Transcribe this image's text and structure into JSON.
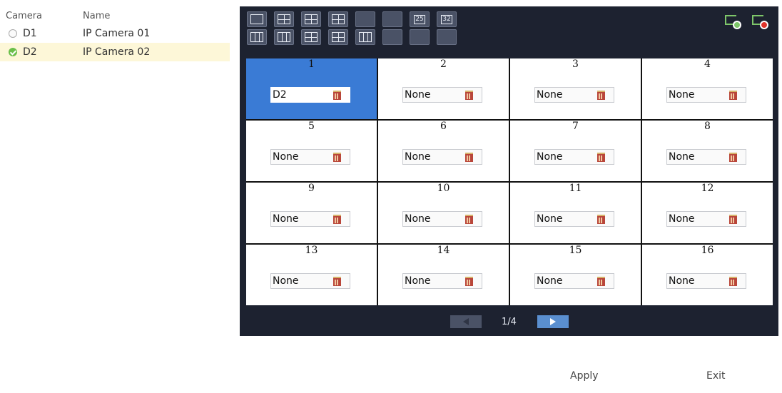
{
  "camera_list": {
    "header": {
      "camera": "Camera",
      "name": "Name"
    },
    "rows": [
      {
        "id": "D1",
        "name": "IP Camera 01",
        "status": "unselected"
      },
      {
        "id": "D2",
        "name": "IP Camera 02",
        "status": "selected"
      }
    ]
  },
  "toolbar": {
    "row1": [
      {
        "icon": "layout-1-icon"
      },
      {
        "icon": "layout-4-icon"
      },
      {
        "icon": "layout-6-icon"
      },
      {
        "icon": "layout-8-icon"
      },
      {
        "icon": "layout-9-icon"
      },
      {
        "icon": "layout-16-icon"
      },
      {
        "icon": "layout-25-icon",
        "label": "25"
      },
      {
        "icon": "layout-32-icon",
        "label": "32"
      }
    ],
    "row2_icons": [
      "layout-3col-icon",
      "layout-4col-icon",
      "layout-alt1-icon",
      "layout-alt2-icon",
      "layout-alt3-icon",
      "layout-alt4-icon",
      "layout-alt5-icon",
      "layout-alt6-icon"
    ]
  },
  "top_icons": {
    "add": "add-camera-icon",
    "delete": "delete-camera-icon"
  },
  "grid": {
    "cells": [
      {
        "num": "1",
        "value": "D2",
        "active": true
      },
      {
        "num": "2",
        "value": "None"
      },
      {
        "num": "3",
        "value": "None"
      },
      {
        "num": "4",
        "value": "None"
      },
      {
        "num": "5",
        "value": "None"
      },
      {
        "num": "6",
        "value": "None"
      },
      {
        "num": "7",
        "value": "None"
      },
      {
        "num": "8",
        "value": "None"
      },
      {
        "num": "9",
        "value": "None"
      },
      {
        "num": "10",
        "value": "None"
      },
      {
        "num": "11",
        "value": "None"
      },
      {
        "num": "12",
        "value": "None"
      },
      {
        "num": "13",
        "value": "None"
      },
      {
        "num": "14",
        "value": "None"
      },
      {
        "num": "15",
        "value": "None"
      },
      {
        "num": "16",
        "value": "None"
      }
    ]
  },
  "pager": {
    "label": "1/4"
  },
  "footer": {
    "apply": "Apply",
    "exit": "Exit"
  },
  "colors": {
    "panel_bg": "#1d2230",
    "active_cell": "#3a7bd5",
    "selected_row": "#fdf7d8",
    "status_on": "#6bbf4a"
  }
}
